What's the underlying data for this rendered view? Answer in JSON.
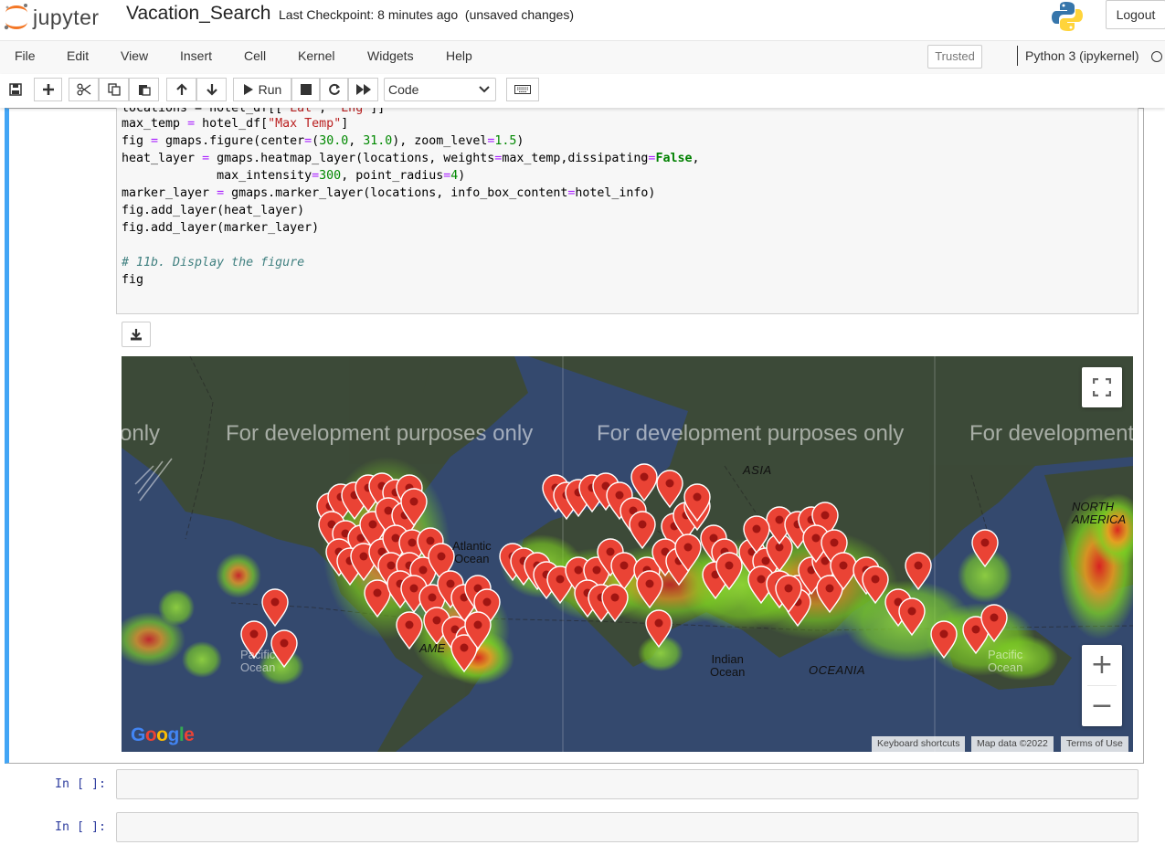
{
  "header": {
    "logo_text": "jupyter",
    "notebook_name": "Vacation_Search",
    "checkpoint": "Last Checkpoint: 8 minutes ago",
    "status": "(unsaved changes)",
    "logout_label": "Logout"
  },
  "menubar": {
    "items": [
      "File",
      "Edit",
      "View",
      "Insert",
      "Cell",
      "Kernel",
      "Widgets",
      "Help"
    ],
    "trusted_label": "Trusted",
    "kernel_name": "Python 3 (ipykernel)"
  },
  "toolbar": {
    "run_label": "Run",
    "cell_type": "Code",
    "buttons": [
      "save-icon",
      "add-icon",
      "cut-icon",
      "copy-icon",
      "paste-icon",
      "move-up-icon",
      "move-down-icon",
      "run-icon",
      "stop-icon",
      "restart-icon",
      "fast-forward-icon",
      "keyboard-icon"
    ]
  },
  "code_cell": {
    "lines": [
      "locations = hotel_df[[\"Lat\", \"Lng\"]]",
      "max_temp = hotel_df[\"Max Temp\"]",
      "fig = gmaps.figure(center=(30.0, 31.0), zoom_level=1.5)",
      "heat_layer = gmaps.heatmap_layer(locations, weights=max_temp,dissipating=False,",
      "             max_intensity=300, point_radius=4)",
      "marker_layer = gmaps.marker_layer(locations, info_box_content=hotel_info)",
      "fig.add_layer(heat_layer)",
      "fig.add_layer(marker_layer)",
      "",
      "# 11b. Display the figure",
      "fig"
    ]
  },
  "map": {
    "watermark": "For development purposes only",
    "watermark_left": "only",
    "watermark_right": "For development",
    "labels": {
      "asia": "ASIA",
      "north_america": "NORTH\nAMERICA",
      "atlantic": "Atlantic\nOcean",
      "indian": "Indian\nOcean",
      "oceania": "OCEANIA",
      "south_america": "AME",
      "pacific_left": "Pacific\nOcean",
      "pacific_right": "Pacific\nOcean"
    },
    "google_logo": "Google",
    "attribution": [
      "Keyboard shortcuts",
      "Map data ©2022",
      "Terms of Use"
    ],
    "zoom_in": "+",
    "zoom_out": "−",
    "colors": {
      "ocean": "#34496e",
      "land": "#3d4a32",
      "marker": "#e74c3c",
      "heat_low": "#7ed321",
      "heat_high": "#e02020"
    }
  },
  "empty_cells": [
    {
      "prompt": "In [ ]:"
    },
    {
      "prompt": "In [ ]:"
    }
  ]
}
